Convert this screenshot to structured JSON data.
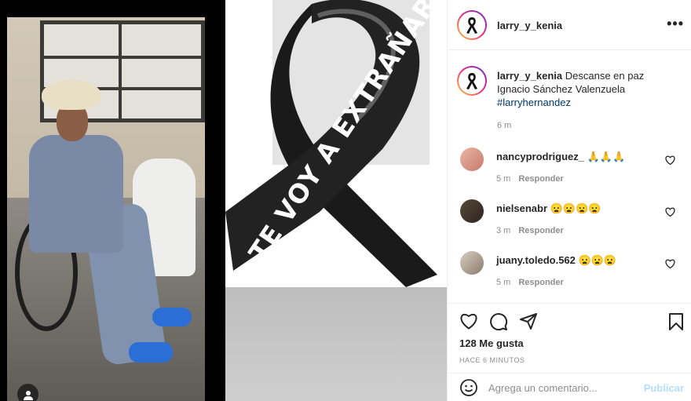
{
  "post": {
    "username": "larry_y_kenia",
    "more_label": "•••",
    "caption_user": "larry_y_kenia",
    "caption_line1": " Descanse en paz",
    "caption_line2": "Ignacio Sánchez Valenzuela",
    "caption_hashtag": "#larryhernandez",
    "caption_time": "6 m",
    "ribbon_text": "TE VOY A EXTRAÑAR"
  },
  "comments": [
    {
      "username": "nancyprodriguez_",
      "text": "🙏🙏🙏",
      "time": "5 m",
      "reply": "Responder"
    },
    {
      "username": "nielsenabr",
      "text": "😦😦😦😦",
      "time": "3 m",
      "reply": "Responder"
    },
    {
      "username": "juany.toledo.562",
      "text": "😦😦😦",
      "time": "5 m",
      "reply": "Responder"
    }
  ],
  "footer": {
    "likes": "128 Me gusta",
    "ago": "HACE 6 MINUTOS",
    "comment_placeholder": "Agrega un comentario...",
    "publish": "Publicar"
  },
  "colors": {
    "link": "#00376b",
    "publish": "#b2dffc",
    "muted": "#8e8e8e"
  }
}
